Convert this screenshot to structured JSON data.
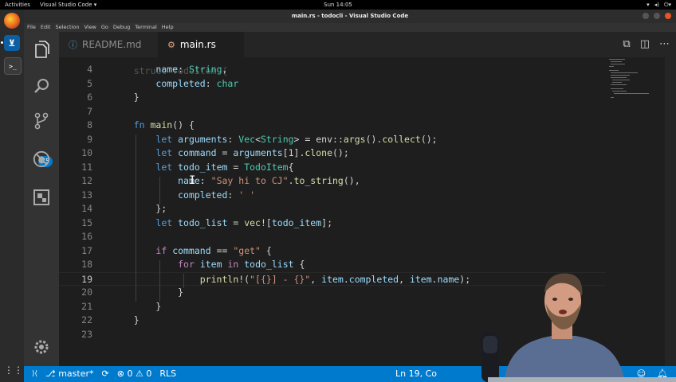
{
  "topbar": {
    "activities": "Activities",
    "app_name": "Visual Studio Code ▾",
    "clock": "Sun 14:05"
  },
  "window": {
    "title": "main.rs - todocli - Visual Studio Code"
  },
  "menubar": {
    "items": [
      "File",
      "Edit",
      "Selection",
      "View",
      "Go",
      "Debug",
      "Terminal",
      "Help"
    ]
  },
  "activitybar": {
    "badge": "75"
  },
  "tabs": [
    {
      "label": "README.md",
      "active": false
    },
    {
      "label": "main.rs",
      "active": true
    }
  ],
  "editor": {
    "lines": [
      {
        "n": "4",
        "tokens": [
          [
            "pl",
            "        "
          ],
          [
            "va",
            "name"
          ],
          [
            "pl",
            ": "
          ],
          [
            "ty",
            "String"
          ],
          [
            "pl",
            ","
          ]
        ]
      },
      {
        "n": "5",
        "tokens": [
          [
            "pl",
            "        "
          ],
          [
            "va",
            "completed"
          ],
          [
            "pl",
            ": "
          ],
          [
            "ty",
            "char"
          ]
        ]
      },
      {
        "n": "6",
        "tokens": [
          [
            "pl",
            "    }"
          ]
        ]
      },
      {
        "n": "7",
        "tokens": []
      },
      {
        "n": "8",
        "tokens": [
          [
            "pl",
            "    "
          ],
          [
            "kw",
            "fn"
          ],
          [
            "pl",
            " "
          ],
          [
            "fn",
            "main"
          ],
          [
            "pl",
            "() {"
          ]
        ]
      },
      {
        "n": "9",
        "tokens": [
          [
            "pl",
            "        "
          ],
          [
            "kw",
            "let"
          ],
          [
            "pl",
            " "
          ],
          [
            "va",
            "arguments"
          ],
          [
            "pl",
            ": "
          ],
          [
            "ty",
            "Vec"
          ],
          [
            "pl",
            "<"
          ],
          [
            "ty",
            "String"
          ],
          [
            "pl",
            "> = "
          ],
          [
            "pl",
            "env::"
          ],
          [
            "fn",
            "args"
          ],
          [
            "pl",
            "()."
          ],
          [
            "fn",
            "collect"
          ],
          [
            "pl",
            "();"
          ]
        ]
      },
      {
        "n": "10",
        "tokens": [
          [
            "pl",
            "        "
          ],
          [
            "kw",
            "let"
          ],
          [
            "pl",
            " "
          ],
          [
            "va",
            "command"
          ],
          [
            "pl",
            " = "
          ],
          [
            "va",
            "arguments"
          ],
          [
            "pl",
            "[1]."
          ],
          [
            "fn",
            "clone"
          ],
          [
            "pl",
            "();"
          ]
        ]
      },
      {
        "n": "11",
        "tokens": [
          [
            "pl",
            "        "
          ],
          [
            "kw",
            "let"
          ],
          [
            "pl",
            " "
          ],
          [
            "va",
            "todo_item"
          ],
          [
            "pl",
            " = "
          ],
          [
            "ty",
            "TodoItem"
          ],
          [
            "pl",
            "{"
          ]
        ]
      },
      {
        "n": "12",
        "tokens": [
          [
            "pl",
            "            "
          ],
          [
            "va",
            "name"
          ],
          [
            "pl",
            ": "
          ],
          [
            "st",
            "\"Say hi to CJ\""
          ],
          [
            "pl",
            "."
          ],
          [
            "fn",
            "to_string"
          ],
          [
            "pl",
            "(),"
          ]
        ]
      },
      {
        "n": "13",
        "tokens": [
          [
            "pl",
            "            "
          ],
          [
            "va",
            "completed"
          ],
          [
            "pl",
            ": "
          ],
          [
            "st",
            "' '"
          ]
        ]
      },
      {
        "n": "14",
        "tokens": [
          [
            "pl",
            "        };"
          ]
        ]
      },
      {
        "n": "15",
        "tokens": [
          [
            "pl",
            "        "
          ],
          [
            "kw",
            "let"
          ],
          [
            "pl",
            " "
          ],
          [
            "va",
            "todo_list"
          ],
          [
            "pl",
            " = "
          ],
          [
            "fn",
            "vec!"
          ],
          [
            "pl",
            "["
          ],
          [
            "va",
            "todo_item"
          ],
          [
            "pl",
            "];"
          ]
        ]
      },
      {
        "n": "16",
        "tokens": []
      },
      {
        "n": "17",
        "tokens": [
          [
            "pl",
            "        "
          ],
          [
            "cf",
            "if"
          ],
          [
            "pl",
            " "
          ],
          [
            "va",
            "command"
          ],
          [
            "pl",
            " == "
          ],
          [
            "st",
            "\"get\""
          ],
          [
            "pl",
            " {"
          ]
        ]
      },
      {
        "n": "18",
        "tokens": [
          [
            "pl",
            "            "
          ],
          [
            "cf",
            "for"
          ],
          [
            "pl",
            " "
          ],
          [
            "va",
            "item"
          ],
          [
            "pl",
            " "
          ],
          [
            "cf",
            "in"
          ],
          [
            "pl",
            " "
          ],
          [
            "va",
            "todo_list"
          ],
          [
            "pl",
            " {"
          ]
        ]
      },
      {
        "n": "19",
        "tokens": [
          [
            "pl",
            "                "
          ],
          [
            "fn",
            "println!"
          ],
          [
            "pl",
            "("
          ],
          [
            "st",
            "\"[{}] - {}\""
          ],
          [
            "pl",
            ", "
          ],
          [
            "va",
            "item"
          ],
          [
            "pl",
            "."
          ],
          [
            "va",
            "completed"
          ],
          [
            "pl",
            ", "
          ],
          [
            "va",
            "item"
          ],
          [
            "pl",
            "."
          ],
          [
            "va",
            "name"
          ],
          [
            "pl",
            ");"
          ]
        ]
      },
      {
        "n": "20",
        "tokens": [
          [
            "pl",
            "            }"
          ]
        ]
      },
      {
        "n": "21",
        "tokens": [
          [
            "pl",
            "        }"
          ]
        ]
      },
      {
        "n": "22",
        "tokens": [
          [
            "pl",
            "    }"
          ]
        ]
      },
      {
        "n": "23",
        "tokens": []
      }
    ],
    "current_line": "19"
  },
  "statusbar": {
    "branch": "master*",
    "errors": "0",
    "warnings": "0",
    "rls": "RLS",
    "position": "Ln 19, Co"
  },
  "colors": {
    "accent": "#007acc",
    "keyword": "#569cd6",
    "type": "#4ec9b0",
    "string": "#ce9178",
    "function": "#dcdcaa",
    "variable": "#9cdcfe"
  }
}
